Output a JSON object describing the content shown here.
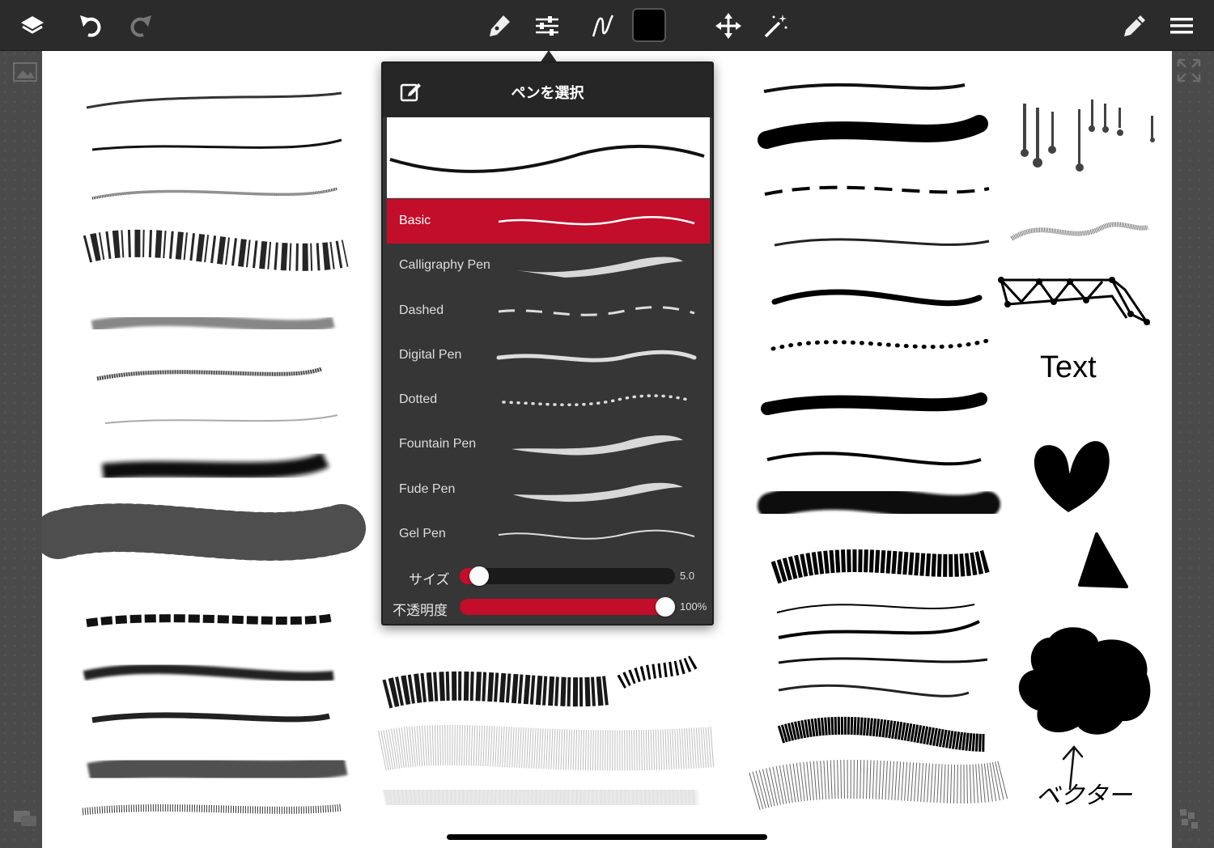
{
  "toolbar": {
    "color": "#000000"
  },
  "panel": {
    "title": "ペンを選択",
    "pens": [
      {
        "name": "Basic",
        "style": "basic",
        "selected": true
      },
      {
        "name": "Calligraphy Pen",
        "style": "calligraphy",
        "selected": false
      },
      {
        "name": "Dashed",
        "style": "dashed",
        "selected": false
      },
      {
        "name": "Digital Pen",
        "style": "digital",
        "selected": false
      },
      {
        "name": "Dotted",
        "style": "dotted",
        "selected": false
      },
      {
        "name": "Fountain Pen",
        "style": "fountain",
        "selected": false
      },
      {
        "name": "Fude Pen",
        "style": "fude",
        "selected": false
      },
      {
        "name": "Gel Pen",
        "style": "gel",
        "selected": false
      }
    ],
    "size": {
      "label": "サイズ",
      "value": "5.0",
      "fraction": 0.05
    },
    "opacity": {
      "label": "不透明度",
      "value": "100%",
      "fraction": 1.0
    }
  },
  "canvas": {
    "text_sample": "Text",
    "vector_note": "ベクター"
  },
  "colors": {
    "accent": "#c20e2a",
    "toolbar_bg": "#2b2b2b",
    "panel_bg": "#363636"
  }
}
